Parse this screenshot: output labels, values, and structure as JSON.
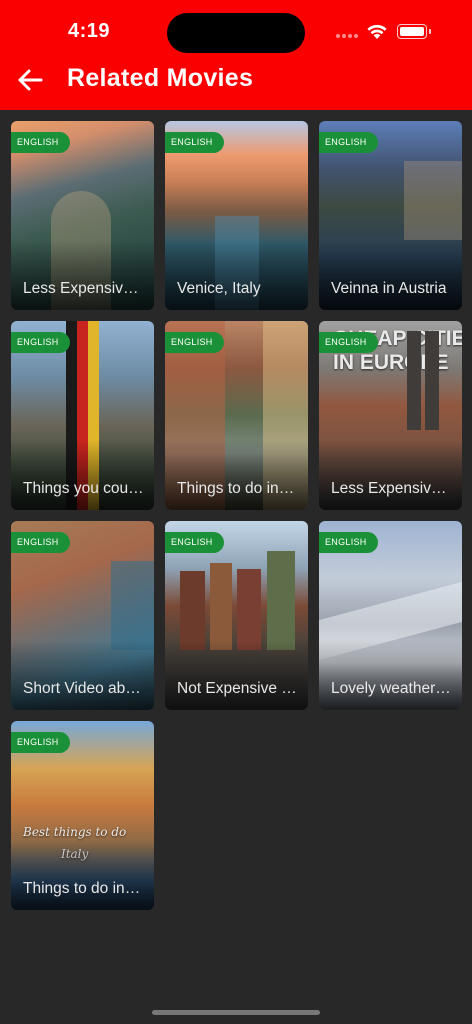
{
  "status_bar": {
    "time": "4:19"
  },
  "header": {
    "title": "Related Movies"
  },
  "movies": [
    {
      "title": "Less Expensive places to visit",
      "language": "ENGLISH"
    },
    {
      "title": "Venice, Italy",
      "language": "ENGLISH"
    },
    {
      "title": "Veinna in Austria",
      "language": "ENGLISH"
    },
    {
      "title": "Things you could do in Germany",
      "language": "ENGLISH"
    },
    {
      "title": "Things to do in Italy",
      "language": "ENGLISH"
    },
    {
      "title": "Less Expensive cities in Europe",
      "language": "ENGLISH",
      "overlay": "CHEAP CITIES\nIN EUROPE"
    },
    {
      "title": "Short Video about Europe",
      "language": "ENGLISH"
    },
    {
      "title": "Not Expensive places",
      "language": "ENGLISH"
    },
    {
      "title": "Lovely weather in Europe",
      "language": "ENGLISH"
    },
    {
      "title": "Things to do in Italy",
      "language": "ENGLISH",
      "overlay": "Best things to do\nItaly"
    }
  ],
  "colors": {
    "header": "#fb0000",
    "background": "#282828",
    "badge": "#1a9138"
  },
  "icons": {
    "back": "arrow-left-icon",
    "wifi": "wifi-icon",
    "battery": "battery-icon"
  }
}
